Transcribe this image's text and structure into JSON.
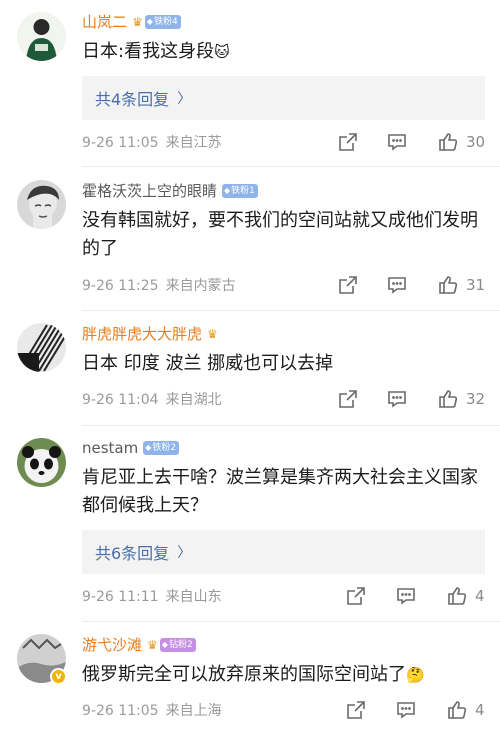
{
  "comments": [
    {
      "name": "山岚二",
      "badge": "铁粉4",
      "text": "日本:看我这身段",
      "emoji": "🐱",
      "replies": "共4条回复",
      "time": "9-26 11:05",
      "location": "来自江苏",
      "likes": "30"
    },
    {
      "name": "霍格沃茨上空的眼睛",
      "badge": "铁粉1",
      "text": "没有韩国就好，要不我们的空间站就又成他们发明的了",
      "time": "9-26 11:25",
      "location": "来自内蒙古",
      "likes": "31"
    },
    {
      "name": "胖虎胖虎大大胖虎",
      "text": "日本 印度 波兰  挪威也可以去掉",
      "time": "9-26 11:04",
      "location": "来自湖北",
      "likes": "32"
    },
    {
      "name": "nestam",
      "badge": "铁粉2",
      "text": "肯尼亚上去干啥？波兰算是集齐两大社会主义国家都伺候我上天？",
      "replies": "共6条回复",
      "time": "9-26 11:11",
      "location": "来自山东",
      "likes": "4"
    },
    {
      "name": "游弋沙滩",
      "badge": "钻粉2",
      "text": "俄罗斯完全可以放弃原来的国际空间站了",
      "emoji": "🤔",
      "time": "9-26 11:05",
      "location": "来自上海",
      "likes": "4"
    }
  ],
  "icons": {
    "share": "share-icon",
    "comment": "comment-icon",
    "like": "thumbs-up-icon",
    "crown": "crown-icon",
    "verified": "verified-v-icon"
  },
  "colors": {
    "vip_name": "#ea7c19",
    "reply_link": "#4a6fa8",
    "iron_badge": "#8fb4ea",
    "diamond_badge": "#c78ee6",
    "meta": "#9a9a9a"
  }
}
